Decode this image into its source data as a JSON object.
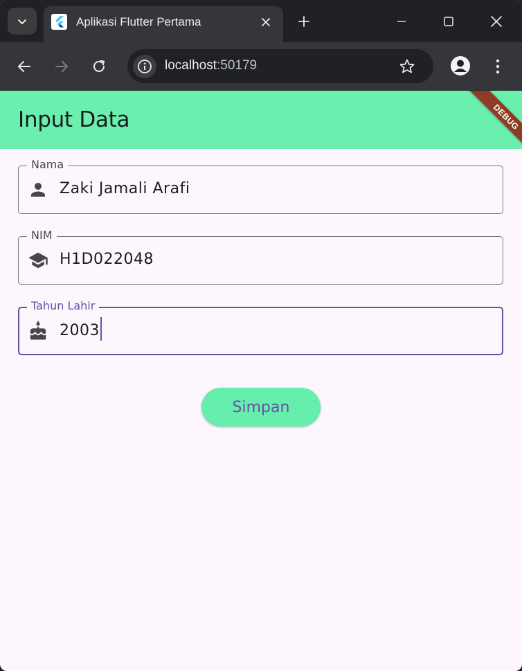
{
  "browser": {
    "tab_title": "Aplikasi Flutter Pertama",
    "url_host": "localhost",
    "url_port": ":50179"
  },
  "app": {
    "title": "Input Data",
    "debug_banner": "DEBUG",
    "appbar_color": "#6aefae",
    "accent_color": "#6750a4"
  },
  "form": {
    "fields": [
      {
        "label": "Nama",
        "value": "Zaki Jamali Arafi",
        "icon": "person-icon"
      },
      {
        "label": "NIM",
        "value": "H1D022048",
        "icon": "school-icon"
      },
      {
        "label": "Tahun Lahir",
        "value": "2003",
        "icon": "cake-icon",
        "focused": true
      }
    ],
    "submit_label": "Simpan"
  }
}
